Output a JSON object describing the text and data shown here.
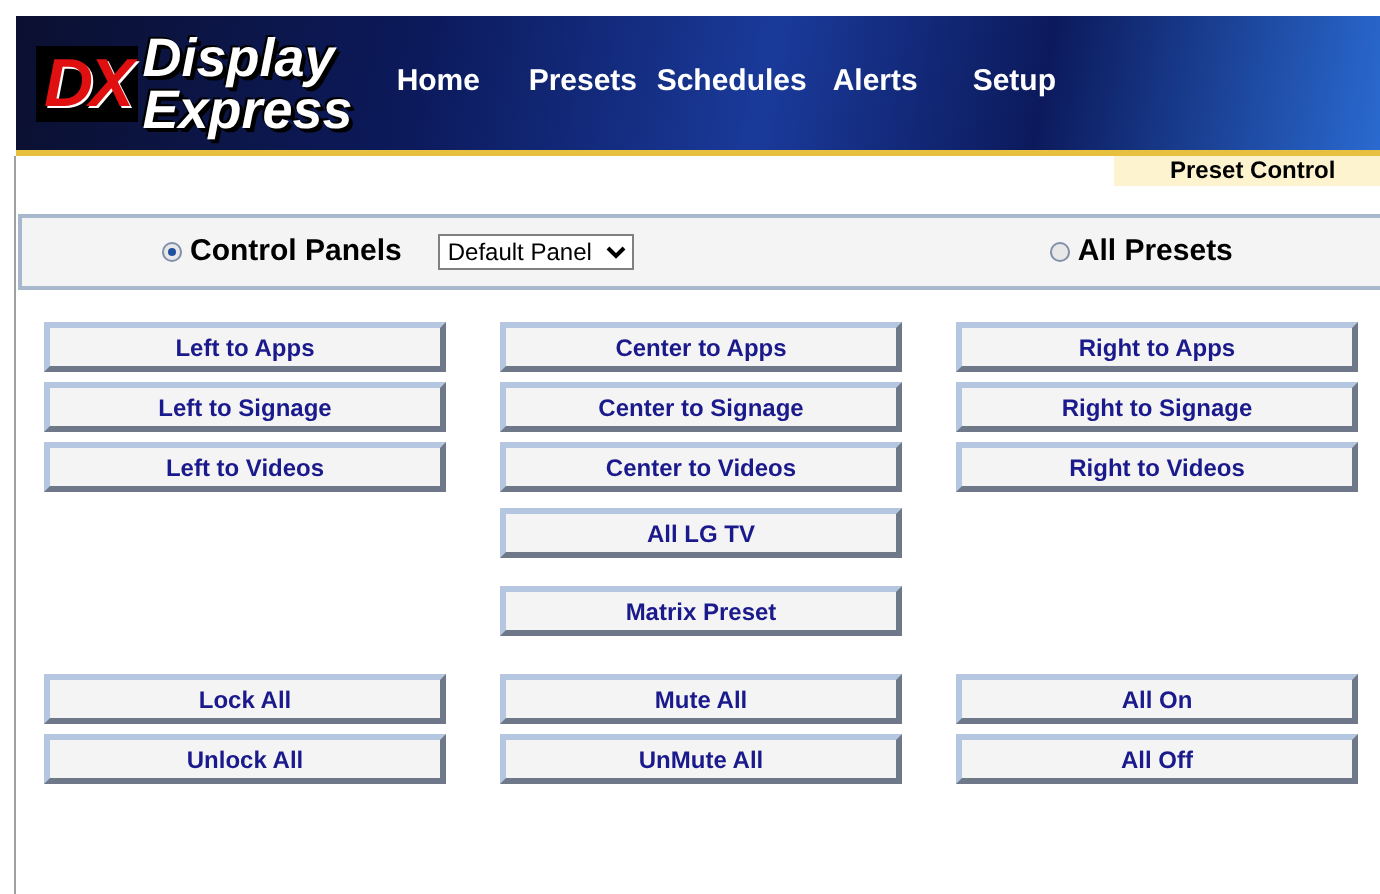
{
  "header": {
    "logo_mark": "DX",
    "logo_line_1": "Display",
    "logo_line_2": "Express",
    "nav": [
      {
        "label": "Home"
      },
      {
        "label": "Presets"
      },
      {
        "label": "Schedules"
      },
      {
        "label": "Alerts"
      },
      {
        "label": "Setup"
      }
    ]
  },
  "page_tab": "Preset Control",
  "mode": {
    "options": [
      {
        "label": "Control Panels",
        "selected": true
      },
      {
        "label": "All Presets",
        "selected": false
      }
    ],
    "panel_select": {
      "value": "Default Panel"
    }
  },
  "groups": [
    {
      "rows": [
        {
          "left": "Left to Apps",
          "center": "Center to Apps",
          "right": "Right to Apps"
        },
        {
          "left": "Left to Signage",
          "center": "Center to Signage",
          "right": "Right to Signage"
        },
        {
          "left": "Left to Videos",
          "center": "Center to Videos",
          "right": "Right to Videos"
        }
      ]
    },
    {
      "rows": [
        {
          "center": "All LG TV"
        }
      ]
    },
    {
      "rows": [
        {
          "center": "Matrix Preset"
        }
      ]
    },
    {
      "rows": [
        {
          "left": "Lock All",
          "center": "Mute All",
          "right": "All On"
        },
        {
          "left": "Unlock All",
          "center": "UnMute All",
          "right": "All Off"
        }
      ]
    }
  ]
}
